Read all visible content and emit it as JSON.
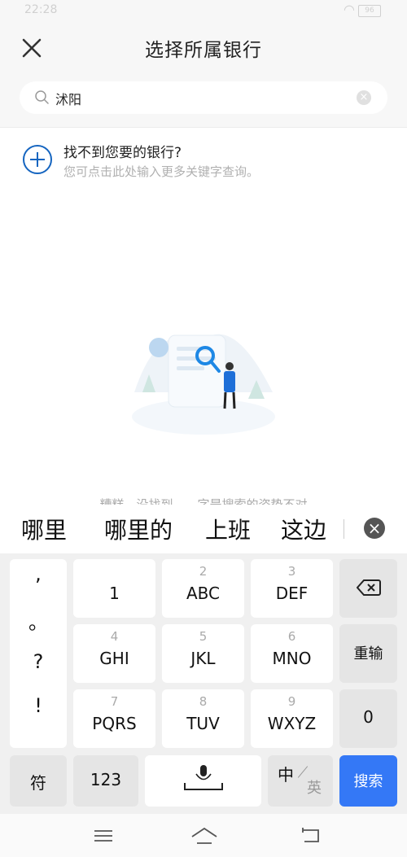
{
  "status": {
    "time": "22:28",
    "battery": "96"
  },
  "header": {
    "title": "选择所属银行"
  },
  "search": {
    "value": "沭阳"
  },
  "not_found": {
    "title": "找不到您要的银行?",
    "subtitle": "您可点击此处输入更多关键字查询。"
  },
  "empty_state": {
    "text": "糟糕，没找到……字是搜索的姿势不对"
  },
  "candidates": [
    "哪里",
    "哪里的",
    "上班",
    "这边"
  ],
  "keyboard": {
    "punct": [
      ",",
      "。",
      "?",
      "!"
    ],
    "keys": [
      {
        "num": "",
        "letters": "1"
      },
      {
        "num": "2",
        "letters": "ABC"
      },
      {
        "num": "3",
        "letters": "DEF"
      },
      {
        "num": "4",
        "letters": "GHI"
      },
      {
        "num": "5",
        "letters": "JKL"
      },
      {
        "num": "6",
        "letters": "MNO"
      },
      {
        "num": "7",
        "letters": "PQRS"
      },
      {
        "num": "8",
        "letters": "TUV"
      },
      {
        "num": "9",
        "letters": "WXYZ"
      }
    ],
    "reinput": "重输",
    "zero": "0",
    "symbol": "符",
    "numbers": "123",
    "lang_zh": "中",
    "lang_en": "英",
    "search": "搜索"
  }
}
